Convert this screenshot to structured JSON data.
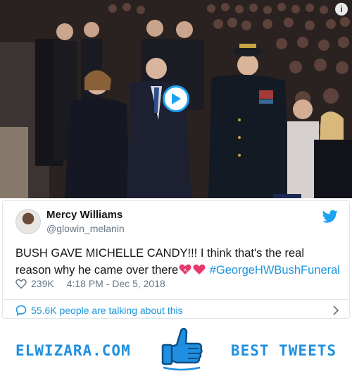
{
  "media": {
    "info_icon": "info-icon",
    "play_icon": "play-icon"
  },
  "tweet": {
    "author_name": "Mercy Williams",
    "author_handle": "@glowin_melanin",
    "text_main": "BUSH GAVE MICHELLE CANDY!!! I think that's the real reason why he came over there",
    "hashtag": "#GeorgeHWBushFuneral",
    "likes": "239K",
    "timestamp": "4:18 PM - Dec 5, 2018",
    "talking": "55.6K people are talking about this",
    "bird_icon": "twitter-bird-icon",
    "accent": "#1da1f2"
  },
  "banner": {
    "left_text": "ELWIZARA.COM",
    "right_text": "BEST TWEETS",
    "brand_color": "#1f8fe0"
  }
}
